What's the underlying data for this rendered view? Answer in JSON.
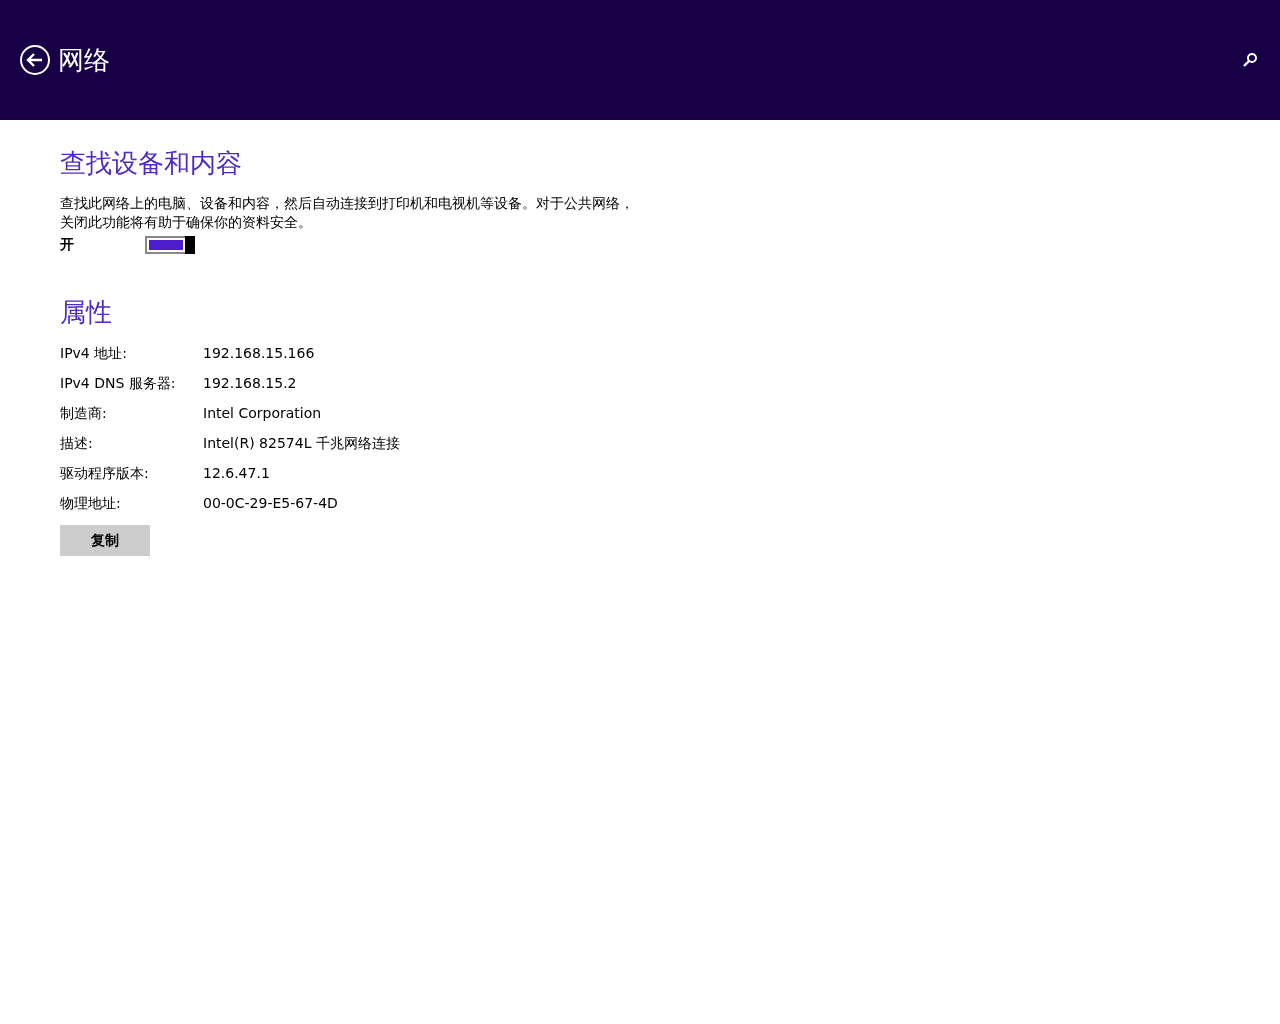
{
  "header": {
    "title": "网络"
  },
  "discovery": {
    "heading": "查找设备和内容",
    "description": "查找此网络上的电脑、设备和内容，然后自动连接到打印机和电视机等设备。对于公共网络，关闭此功能将有助于确保你的资料安全。",
    "toggle": {
      "label": "开",
      "on": true
    }
  },
  "properties": {
    "heading": "属性",
    "rows": [
      {
        "label": "IPv4 地址:",
        "value": "192.168.15.166"
      },
      {
        "label": "IPv4 DNS 服务器:",
        "value": "192.168.15.2"
      },
      {
        "label": "制造商:",
        "value": "Intel Corporation"
      },
      {
        "label": "描述:",
        "value": "Intel(R) 82574L 千兆网络连接"
      },
      {
        "label": "驱动程序版本:",
        "value": "12.6.47.1"
      },
      {
        "label": "物理地址:",
        "value": "00-0C-29-E5-67-4D"
      }
    ],
    "button": "复制"
  }
}
